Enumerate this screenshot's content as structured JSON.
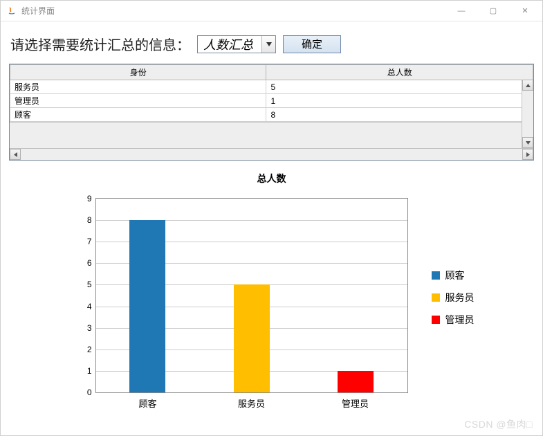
{
  "window": {
    "title": "统计界面",
    "win_controls": {
      "min": "—",
      "max": "▢",
      "close": "✕"
    }
  },
  "prompt": {
    "label": "请选择需要统计汇总的信息：",
    "combo_value": "人数汇总",
    "ok_label": "确定"
  },
  "table": {
    "headers": [
      "身份",
      "总人数"
    ],
    "rows": [
      {
        "role": "服务员",
        "count": "5"
      },
      {
        "role": "管理员",
        "count": "1"
      },
      {
        "role": "顾客",
        "count": "8"
      }
    ]
  },
  "chart_data": {
    "type": "bar",
    "title": "总人数",
    "xlabel": "",
    "ylabel": "",
    "categories": [
      "顾客",
      "服务员",
      "管理员"
    ],
    "series": [
      {
        "name": "顾客",
        "values": [
          8,
          null,
          null
        ],
        "color": "#1f77b4"
      },
      {
        "name": "服务员",
        "values": [
          null,
          5,
          null
        ],
        "color": "#ffbf00"
      },
      {
        "name": "管理员",
        "values": [
          null,
          null,
          1
        ],
        "color": "#ff0000"
      }
    ],
    "ylim": [
      0,
      9
    ],
    "yticks": [
      0,
      1,
      2,
      3,
      4,
      5,
      6,
      7,
      8,
      9
    ],
    "legend": [
      {
        "name": "顾客",
        "color": "#1f77b4"
      },
      {
        "name": "服务员",
        "color": "#ffbf00"
      },
      {
        "name": "管理员",
        "color": "#ff0000"
      }
    ],
    "bar_values": [
      {
        "label": "顾客",
        "value": 8,
        "color": "#1f77b4"
      },
      {
        "label": "服务员",
        "value": 5,
        "color": "#ffbf00"
      },
      {
        "label": "管理员",
        "value": 1,
        "color": "#ff0000"
      }
    ]
  },
  "watermark": "CSDN @鱼肉□"
}
